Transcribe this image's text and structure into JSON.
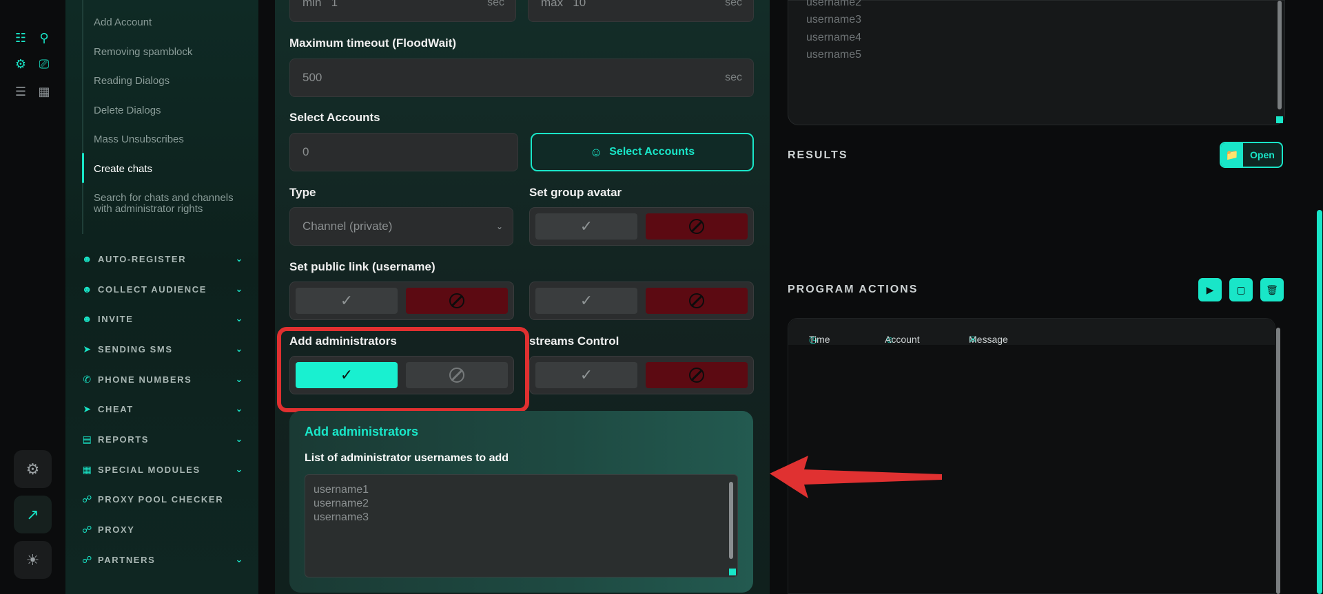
{
  "nav": {
    "subitems": [
      {
        "label": "Add Account",
        "top": 0
      },
      {
        "label": "Removing spamblock"
      },
      {
        "label": "Reading Dialogs"
      },
      {
        "label": "Delete Dialogs"
      },
      {
        "label": "Mass Unsubscribes"
      },
      {
        "label": "Create chats"
      },
      {
        "label": "Search for chats and channels with administrator rights"
      }
    ],
    "sections": [
      {
        "label": "AUTO-REGISTER",
        "icon": "user-plus-icon"
      },
      {
        "label": "COLLECT AUDIENCE",
        "icon": "users-icon"
      },
      {
        "label": "INVITE",
        "icon": "users-icon"
      },
      {
        "label": "SENDING SMS",
        "icon": "send-icon"
      },
      {
        "label": "PHONE NUMBERS",
        "icon": "phone-icon"
      },
      {
        "label": "CHEAT",
        "icon": "send-icon"
      },
      {
        "label": "REPORTS",
        "icon": "report-icon"
      },
      {
        "label": "SPECIAL MODULES",
        "icon": "modules-icon"
      },
      {
        "label": "PROXY POOL CHECKER",
        "icon": "network-icon"
      },
      {
        "label": "PROXY",
        "icon": "network-icon"
      },
      {
        "label": "PARTNERS",
        "icon": "network-icon"
      }
    ]
  },
  "form": {
    "min_prefix": "min",
    "min_value": "1",
    "max_prefix": "max",
    "max_value": "10",
    "unit": "sec",
    "floodwait_label": "Maximum timeout (FloodWait)",
    "floodwait_value": "500",
    "select_accounts_label": "Select Accounts",
    "accounts_count": "0",
    "select_accounts_button": "Select Accounts",
    "type_label": "Type",
    "type_value": "Channel (private)",
    "set_group_avatar_label": "Set group avatar",
    "set_public_link_label": "Set public link (username)",
    "add_administrators_label": "Add administrators",
    "streams_control_label": "streams Control",
    "admins_panel_title": "Add administrators",
    "admins_list_label": "List of administrator usernames to add",
    "admins_placeholder": [
      "username1",
      "username2",
      "username3"
    ]
  },
  "right": {
    "top_list": [
      "username2",
      "username3",
      "username4",
      "username5"
    ],
    "results_label": "RESULTS",
    "open_button": "Open",
    "program_actions_label": "PROGRAM ACTIONS",
    "columns": [
      "Time",
      "Account",
      "Message"
    ]
  },
  "colors": {
    "accent": "#19e6c8",
    "danger": "#5c0a12",
    "highlight": "#e03030"
  }
}
